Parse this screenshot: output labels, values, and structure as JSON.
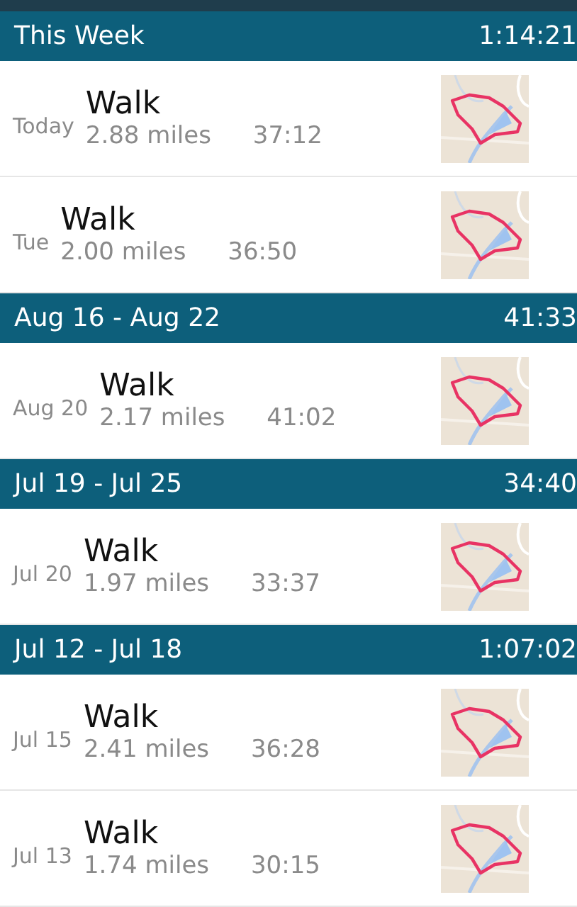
{
  "weeks": [
    {
      "label": "This Week",
      "total": "1:14:21",
      "activities": [
        {
          "day": "Today",
          "title": "Walk",
          "distance": "2.88 miles",
          "duration": "37:12"
        },
        {
          "day": "Tue",
          "title": "Walk",
          "distance": "2.00 miles",
          "duration": "36:50"
        }
      ]
    },
    {
      "label": "Aug 16 - Aug 22",
      "total": "41:33",
      "activities": [
        {
          "day": "Aug 20",
          "title": "Walk",
          "distance": "2.17 miles",
          "duration": "41:02"
        }
      ]
    },
    {
      "label": "Jul 19 - Jul 25",
      "total": "34:40",
      "activities": [
        {
          "day": "Jul 20",
          "title": "Walk",
          "distance": "1.97 miles",
          "duration": "33:37"
        }
      ]
    },
    {
      "label": "Jul 12 - Jul 18",
      "total": "1:07:02",
      "activities": [
        {
          "day": "Jul 15",
          "title": "Walk",
          "distance": "2.41 miles",
          "duration": "36:28"
        },
        {
          "day": "Jul 13",
          "title": "Walk",
          "distance": "1.74 miles",
          "duration": "30:15"
        }
      ]
    }
  ]
}
